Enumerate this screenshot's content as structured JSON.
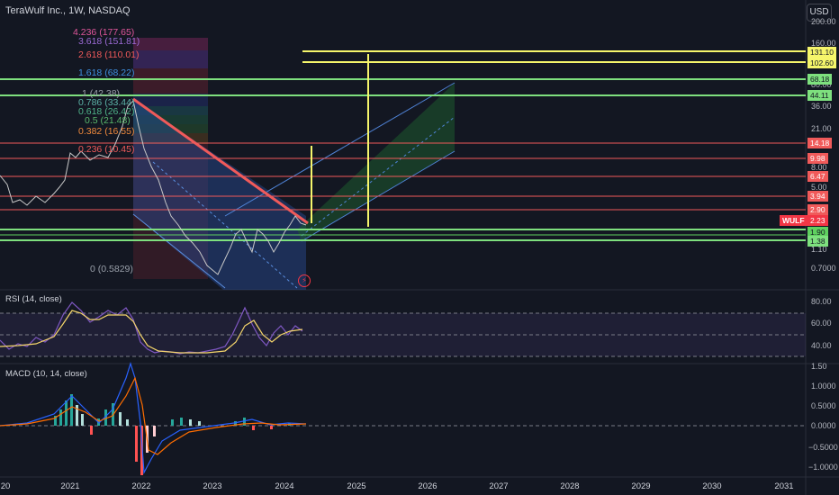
{
  "header": {
    "symbol_title": "TeraWulf Inc., 1W, NASDAQ",
    "currency_button": "USD"
  },
  "price_axis": {
    "labels": [
      "200.00",
      "160.00",
      "80.00",
      "36.00",
      "21.00",
      "8.00",
      "5.00",
      "1.10",
      "0.7000"
    ]
  },
  "price_tags": [
    {
      "value": "131.10",
      "color": "#f5f56b"
    },
    {
      "value": "102.60",
      "color": "#f5f56b"
    },
    {
      "value": "68.18",
      "color": "#7ee07e"
    },
    {
      "value": "44.11",
      "color": "#7ee07e"
    },
    {
      "value": "14.18",
      "color": "#f05a5a"
    },
    {
      "value": "9.98",
      "color": "#f05a5a"
    },
    {
      "value": "6.47",
      "color": "#f05a5a"
    },
    {
      "value": "3.94",
      "color": "#f05a5a"
    },
    {
      "value": "2.90",
      "color": "#f05a5a"
    },
    {
      "value": "2.23",
      "color": "#f23645"
    },
    {
      "value": "1.90",
      "color": "#5fd05f"
    },
    {
      "value": "1.38",
      "color": "#7ee07e"
    }
  ],
  "ticker_tag": "WULF",
  "fib_levels": [
    {
      "text": "4.236 (177.65)",
      "color": "#e0569b"
    },
    {
      "text": "3.618 (151.81)",
      "color": "#9c6bd6"
    },
    {
      "text": "2.618 (110.01)",
      "color": "#f05a5a"
    },
    {
      "text": "1.618 (68.22)",
      "color": "#3f8fe0"
    },
    {
      "text": "1 (42.38)",
      "color": "#9aa0aa"
    },
    {
      "text": "0.786 (33.44)",
      "color": "#5cb3a8"
    },
    {
      "text": "0.618 (26.42)",
      "color": "#4fb38a"
    },
    {
      "text": "0.5 (21.48)",
      "color": "#59b86c"
    },
    {
      "text": "0.382 (16.55)",
      "color": "#f08a3c"
    },
    {
      "text": "0.236 (10.45)",
      "color": "#f05a5a"
    },
    {
      "text": "0 (0.5829)",
      "color": "#9aa0aa"
    }
  ],
  "rsi": {
    "label": "RSI (14, close)",
    "axis": [
      "80.00",
      "60.00",
      "40.00"
    ]
  },
  "macd": {
    "label": "MACD (10, 14, close)",
    "axis": [
      "1.50",
      "1.0000",
      "0.5000",
      "0.0000",
      "−0.5000",
      "−1.0000"
    ]
  },
  "time_axis": [
    "20",
    "2021",
    "2022",
    "2023",
    "2024",
    "2025",
    "2026",
    "2027",
    "2028",
    "2029",
    "2030",
    "2031"
  ],
  "colors": {
    "background": "#131722",
    "red_line": "#f05a5a",
    "green_line": "#7ee07e",
    "yellow_line": "#f5f56b",
    "rsi_line": "#7e57c2",
    "rsi_signal": "#f5d66b"
  }
}
